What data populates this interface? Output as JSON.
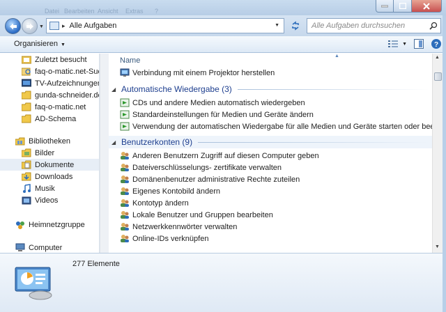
{
  "titlebar": {
    "ghost_menu": [
      "Datei",
      "Bearbeiten",
      "Ansicht",
      "Extras",
      "?"
    ]
  },
  "address": {
    "path": "Alle Aufgaben",
    "separator": "▸"
  },
  "search": {
    "placeholder": "Alle Aufgaben durchsuchen"
  },
  "toolbar": {
    "organize": "Organisieren"
  },
  "navpane": {
    "items": [
      {
        "label": "Zuletzt besucht",
        "icon": "recent-icon"
      },
      {
        "label": "faq-o-matic.net-Suche",
        "icon": "search-folder-icon"
      },
      {
        "label": "TV-Aufzeichnungen",
        "icon": "tv-icon"
      },
      {
        "label": "gunda-schneider.de",
        "icon": "folder-icon"
      },
      {
        "label": "faq-o-matic.net",
        "icon": "folder-icon"
      },
      {
        "label": "AD-Schema",
        "icon": "folder-icon"
      },
      {
        "label": "Bibliotheken",
        "icon": "library-icon"
      },
      {
        "label": "Bilder",
        "icon": "pictures-icon"
      },
      {
        "label": "Dokumente",
        "icon": "documents-icon"
      },
      {
        "label": "Downloads",
        "icon": "downloads-icon"
      },
      {
        "label": "Musik",
        "icon": "music-icon"
      },
      {
        "label": "Videos",
        "icon": "videos-icon"
      },
      {
        "label": "Heimnetzgruppe",
        "icon": "homegroup-icon"
      },
      {
        "label": "Computer",
        "icon": "computer-icon"
      }
    ]
  },
  "content": {
    "column_header": "Name",
    "first_item": "Verbindung mit einem Projektor herstellen",
    "groups": [
      {
        "title": "Automatische Wiedergabe (3)",
        "items": [
          "CDs und andere Medien automatisch wiedergeben",
          "Standardeinstellungen für Medien und Geräte ändern",
          "Verwendung der automatischen Wiedergabe für alle Medien und Geräte starten oder beenden"
        ]
      },
      {
        "title": "Benutzerkonten (9)",
        "items": [
          "Anderen Benutzern Zugriff auf diesen Computer geben",
          "Dateiverschlüsselungs- zertifikate verwalten",
          "Domänenbenutzer administrative Rechte zuteilen",
          "Eigenes Kontobild ändern",
          "Kontotyp ändern",
          "Lokale Benutzer und Gruppen bearbeiten",
          "Netzwerkkennwörter verwalten",
          "Online-IDs verknüpfen"
        ]
      }
    ]
  },
  "details": {
    "count": "277 Elemente"
  },
  "colors": {
    "accent": "#1e3f8f",
    "toolbar": "#dde9f6",
    "selection": "#e7eef6"
  }
}
